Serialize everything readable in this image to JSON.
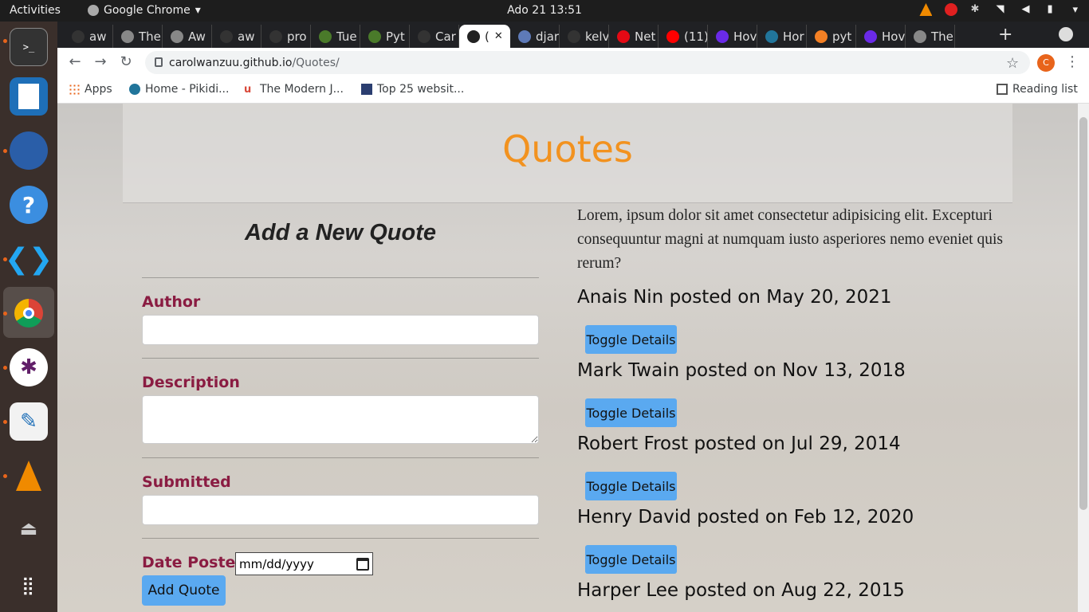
{
  "system": {
    "activities": "Activities",
    "app_name": "Google Chrome",
    "clock": "Ado 21  13:51"
  },
  "browser": {
    "tabs": [
      {
        "label": "aw",
        "icon": "github-icon"
      },
      {
        "label": "The",
        "icon": "globe-icon"
      },
      {
        "label": "Aw",
        "icon": "globe-icon"
      },
      {
        "label": "aw",
        "icon": "github-icon"
      },
      {
        "label": "pro",
        "icon": "github-icon"
      },
      {
        "label": "Tue",
        "icon": "palm-icon"
      },
      {
        "label": "Pyt",
        "icon": "palm-icon"
      },
      {
        "label": "Car",
        "icon": "github-icon"
      },
      {
        "label": "(",
        "icon": "angular-icon"
      },
      {
        "label": "djar",
        "icon": "doc-icon"
      },
      {
        "label": "kelv",
        "icon": "github-icon"
      },
      {
        "label": "Net",
        "icon": "netflix-icon"
      },
      {
        "label": "(11)",
        "icon": "youtube-icon"
      },
      {
        "label": "Hov",
        "icon": "purple-icon"
      },
      {
        "label": "Hor",
        "icon": "wordpress-icon"
      },
      {
        "label": "pyt",
        "icon": "stackoverflow-icon"
      },
      {
        "label": "Hov",
        "icon": "purple-icon"
      },
      {
        "label": "The",
        "icon": "globe-icon"
      }
    ],
    "url_host": "carolwanzuu.github.io",
    "url_path": "/Quotes/",
    "profile_initial": "C",
    "bookmarks": [
      "Apps",
      "Home - Pikidi...",
      "The Modern J...",
      "Top 25 websit..."
    ],
    "reading_list": "Reading list"
  },
  "page": {
    "title": "Quotes",
    "form": {
      "heading": "Add a New Quote",
      "author_label": "Author",
      "description_label": "Description",
      "submitted_label": "Submitted",
      "date_label": "Date Posted",
      "date_placeholder": "mm/dd/yyyy",
      "submit_label": "Add Quote"
    },
    "intro": "Lorem, ipsum dolor sit amet consectetur adipisicing elit. Excepturi consequuntur magni at numquam iusto asperiores nemo eveniet quis rerum?",
    "toggle_label": "Toggle Details",
    "quotes": [
      "Anais Nin posted on May 20, 2021",
      "Mark Twain posted on Nov 13, 2018",
      "Robert Frost posted on Jul 29, 2014",
      "Henry David posted on Feb 12, 2020",
      "Harper Lee posted on Aug 22, 2015"
    ]
  }
}
